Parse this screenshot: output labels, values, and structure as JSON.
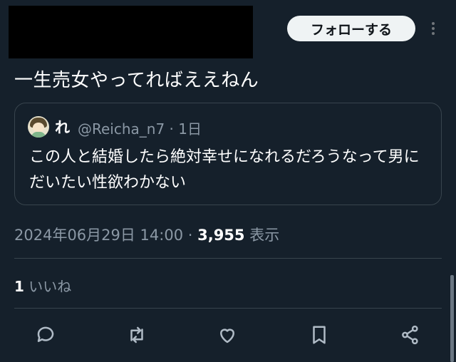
{
  "header": {
    "follow_label": "フォローする",
    "more_icon": "more-vertical-icon"
  },
  "tweet": {
    "text": "一生売女やってればええねん"
  },
  "quote": {
    "name": "れ",
    "handle_time": "@Reicha_n7 · 1日",
    "text": "この人と結婚したら絶対幸せになれるだろうなって男にだいたい性欲わかない"
  },
  "meta": {
    "datetime": "2024年06月29日 14:00 · ",
    "views_count": "3,955",
    "views_label": " 表示"
  },
  "likes": {
    "count": "1",
    "label": " いいね"
  },
  "actions": [
    "reply-icon",
    "retweet-icon",
    "like-icon",
    "bookmark-icon",
    "share-icon"
  ]
}
